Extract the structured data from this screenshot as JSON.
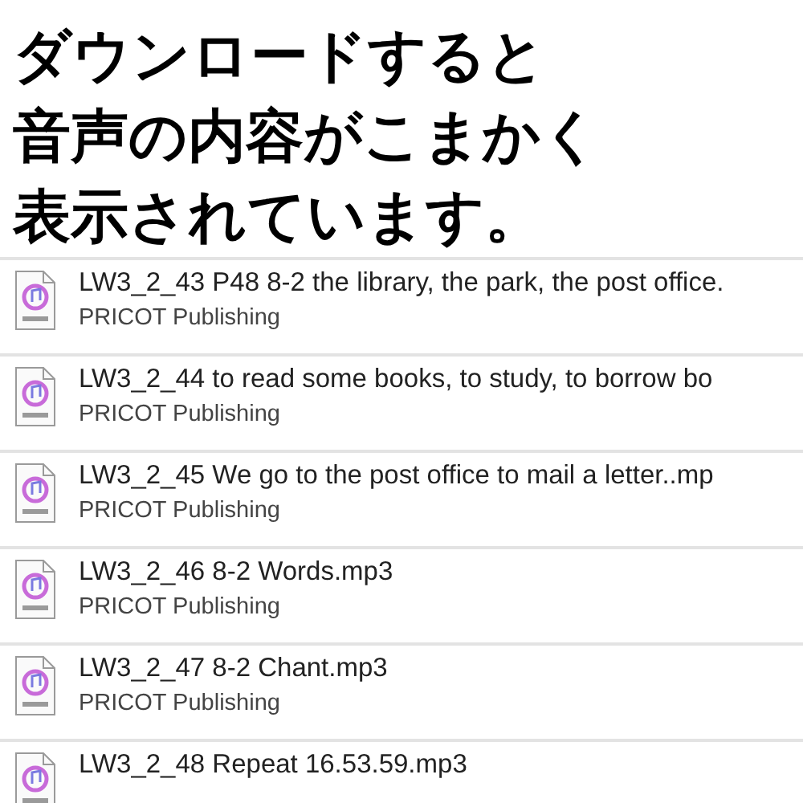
{
  "caption": [
    "ダウンロードすると",
    "音声の内容がこまかく",
    "表示されています。"
  ],
  "files": [
    {
      "title": "LW3_2_43 P48 8-2 the library, the park, the post office.",
      "artist": "PRICOT Publishing"
    },
    {
      "title": "LW3_2_44 to read some books, to study, to borrow bo",
      "artist": "PRICOT Publishing"
    },
    {
      "title": "LW3_2_45 We go to the post office to mail a letter..mp",
      "artist": "PRICOT Publishing"
    },
    {
      "title": "LW3_2_46 8-2 Words.mp3",
      "artist": "PRICOT Publishing"
    },
    {
      "title": "LW3_2_47 8-2 Chant.mp3",
      "artist": "PRICOT Publishing"
    },
    {
      "title": "LW3_2_48 Repeat 16.53.59.mp3"
    }
  ]
}
